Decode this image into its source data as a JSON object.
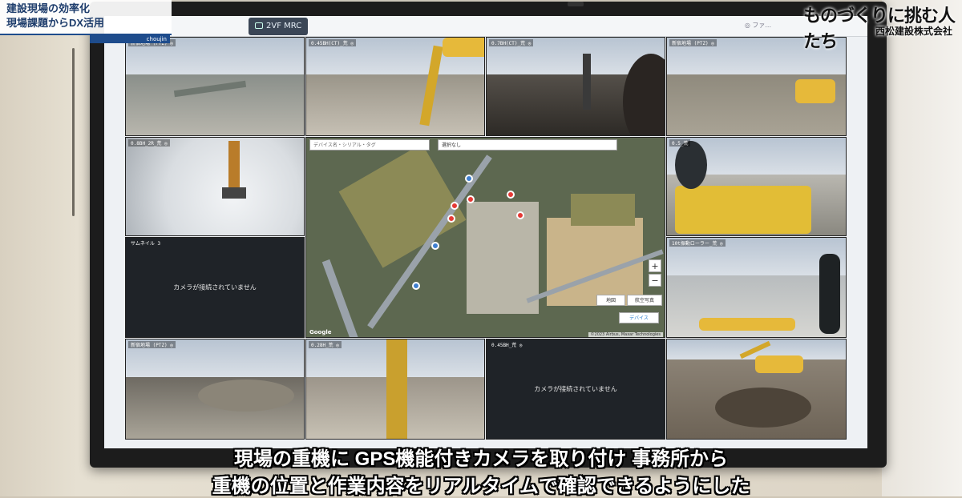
{
  "overlay": {
    "title_line1": "建設現場の効率化",
    "title_line2": "現場課題からDX活用",
    "title_sub": "choujin",
    "logo_brand": "ものづくりに挑む人たち",
    "logo_company": "西松建設株式会社"
  },
  "app": {
    "tab_label": "2VF MRC",
    "right_note": "◎ ファ..."
  },
  "cameras": [
    {
      "label": "新宿地場 (PTZ) ◎",
      "state": "live"
    },
    {
      "label": "0.45BH(CT)_荒 ◎",
      "state": "live"
    },
    {
      "label": "0.7BH(CT)_荒 ◎",
      "state": "live"
    },
    {
      "label": "新宿地場 (PTZ) ◎",
      "state": "live"
    },
    {
      "label": "0.8BH_2R_荒 ◎",
      "state": "live"
    },
    {
      "label": "0.5_荒",
      "state": "live"
    },
    {
      "label": "サムネイル 3",
      "state": "disconnected",
      "message": "カメラが接続されていません"
    },
    {
      "label": "10t振動ローラー_荒 ◎",
      "state": "live"
    },
    {
      "label": "新宿地場 (PTZ) ◎",
      "state": "live"
    },
    {
      "label": "0.28H_荒 ◎",
      "state": "live"
    },
    {
      "label": "0.45BH_荒 ◎",
      "state": "disconnected",
      "message": "カメラが接続されていません"
    },
    {
      "label": "",
      "state": "live"
    }
  ],
  "map": {
    "search_placeholder": "デバイス名・シリアル・タグ",
    "select_value": "選択なし",
    "zoom_in": "+",
    "zoom_out": "−",
    "btn_map": "地図",
    "btn_aerial": "航空写真",
    "btn_device": "デバイス",
    "google_label": "Google",
    "attribution": "©2023 Airbus, Maxar Technologies"
  },
  "subtitles": {
    "line1": "現場の重機に GPS機能付きカメラを取り付け 事務所から",
    "line2": "重機の位置と作業内容をリアルタイムで確認できるようにした"
  }
}
